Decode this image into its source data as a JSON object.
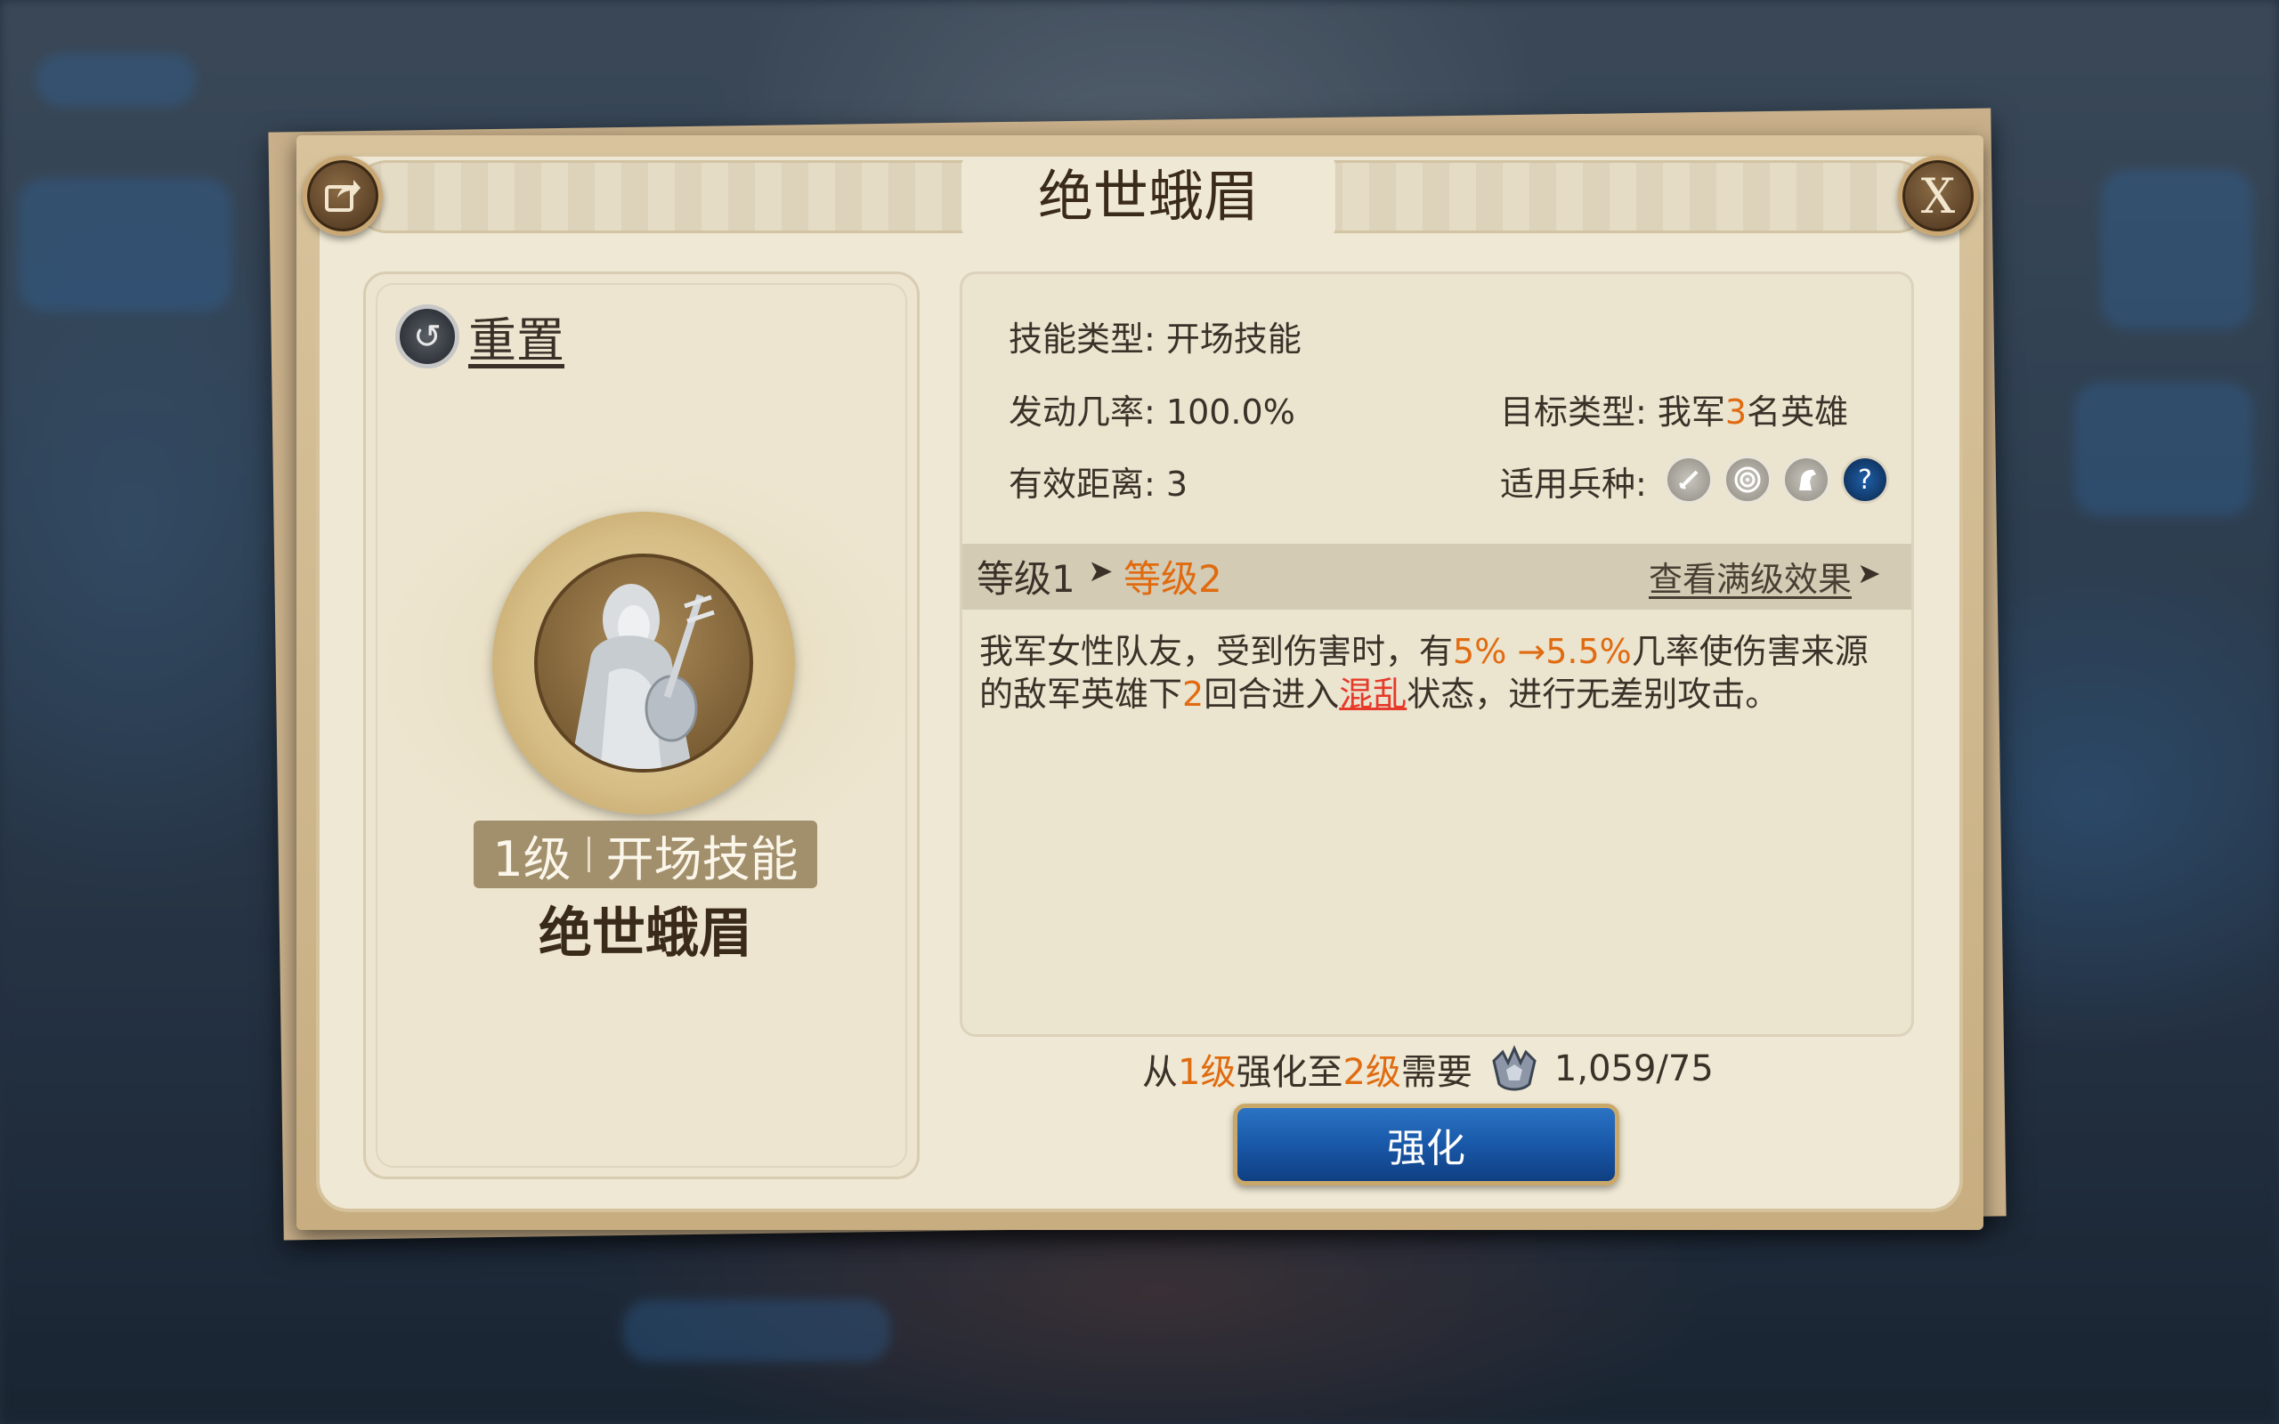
{
  "dialog": {
    "title": "绝世蛾眉",
    "close_label": "X"
  },
  "reset": {
    "label": "重置"
  },
  "skill_card": {
    "level": "1级",
    "type": "开场技能",
    "name": "绝世蛾眉"
  },
  "info": {
    "skill_type_label": "技能类型:",
    "skill_type_value": "开场技能",
    "trigger_rate_label": "发动几率:",
    "trigger_rate_value": "100.0%",
    "target_type_label": "目标类型:",
    "target_prefix": "我军",
    "target_count": "3",
    "target_suffix": "名英雄",
    "range_label": "有效距离:",
    "range_value": "3",
    "unit_types_label": "适用兵种:",
    "unit_icons": [
      "sword-icon",
      "bow-target-icon",
      "horse-icon",
      "question-icon"
    ]
  },
  "level_bar": {
    "current": "等级1",
    "next": "等级2",
    "view_full": "查看满级效果"
  },
  "description": {
    "part1": "我军女性队友，受到伤害时，有",
    "rate_from": "5%",
    "arrow": " →",
    "rate_to": "5.5%",
    "part2": "几率使伤害来源的敌军英雄下",
    "turns": "2",
    "part3": "回合进入",
    "status": "混乱",
    "part4": "状态，进行无差别攻击。"
  },
  "upgrade": {
    "from_prefix": "从",
    "from_level": "1级",
    "to_prefix": " 强化至 ",
    "to_level": "2级",
    "need": "需要",
    "cost": "1,059/75",
    "button_label": "强化"
  },
  "colors": {
    "accent_orange": "#e06b10",
    "status_red": "#e63a2b",
    "button_blue": "#1958a8",
    "panel_bg": "#efe8d4"
  }
}
